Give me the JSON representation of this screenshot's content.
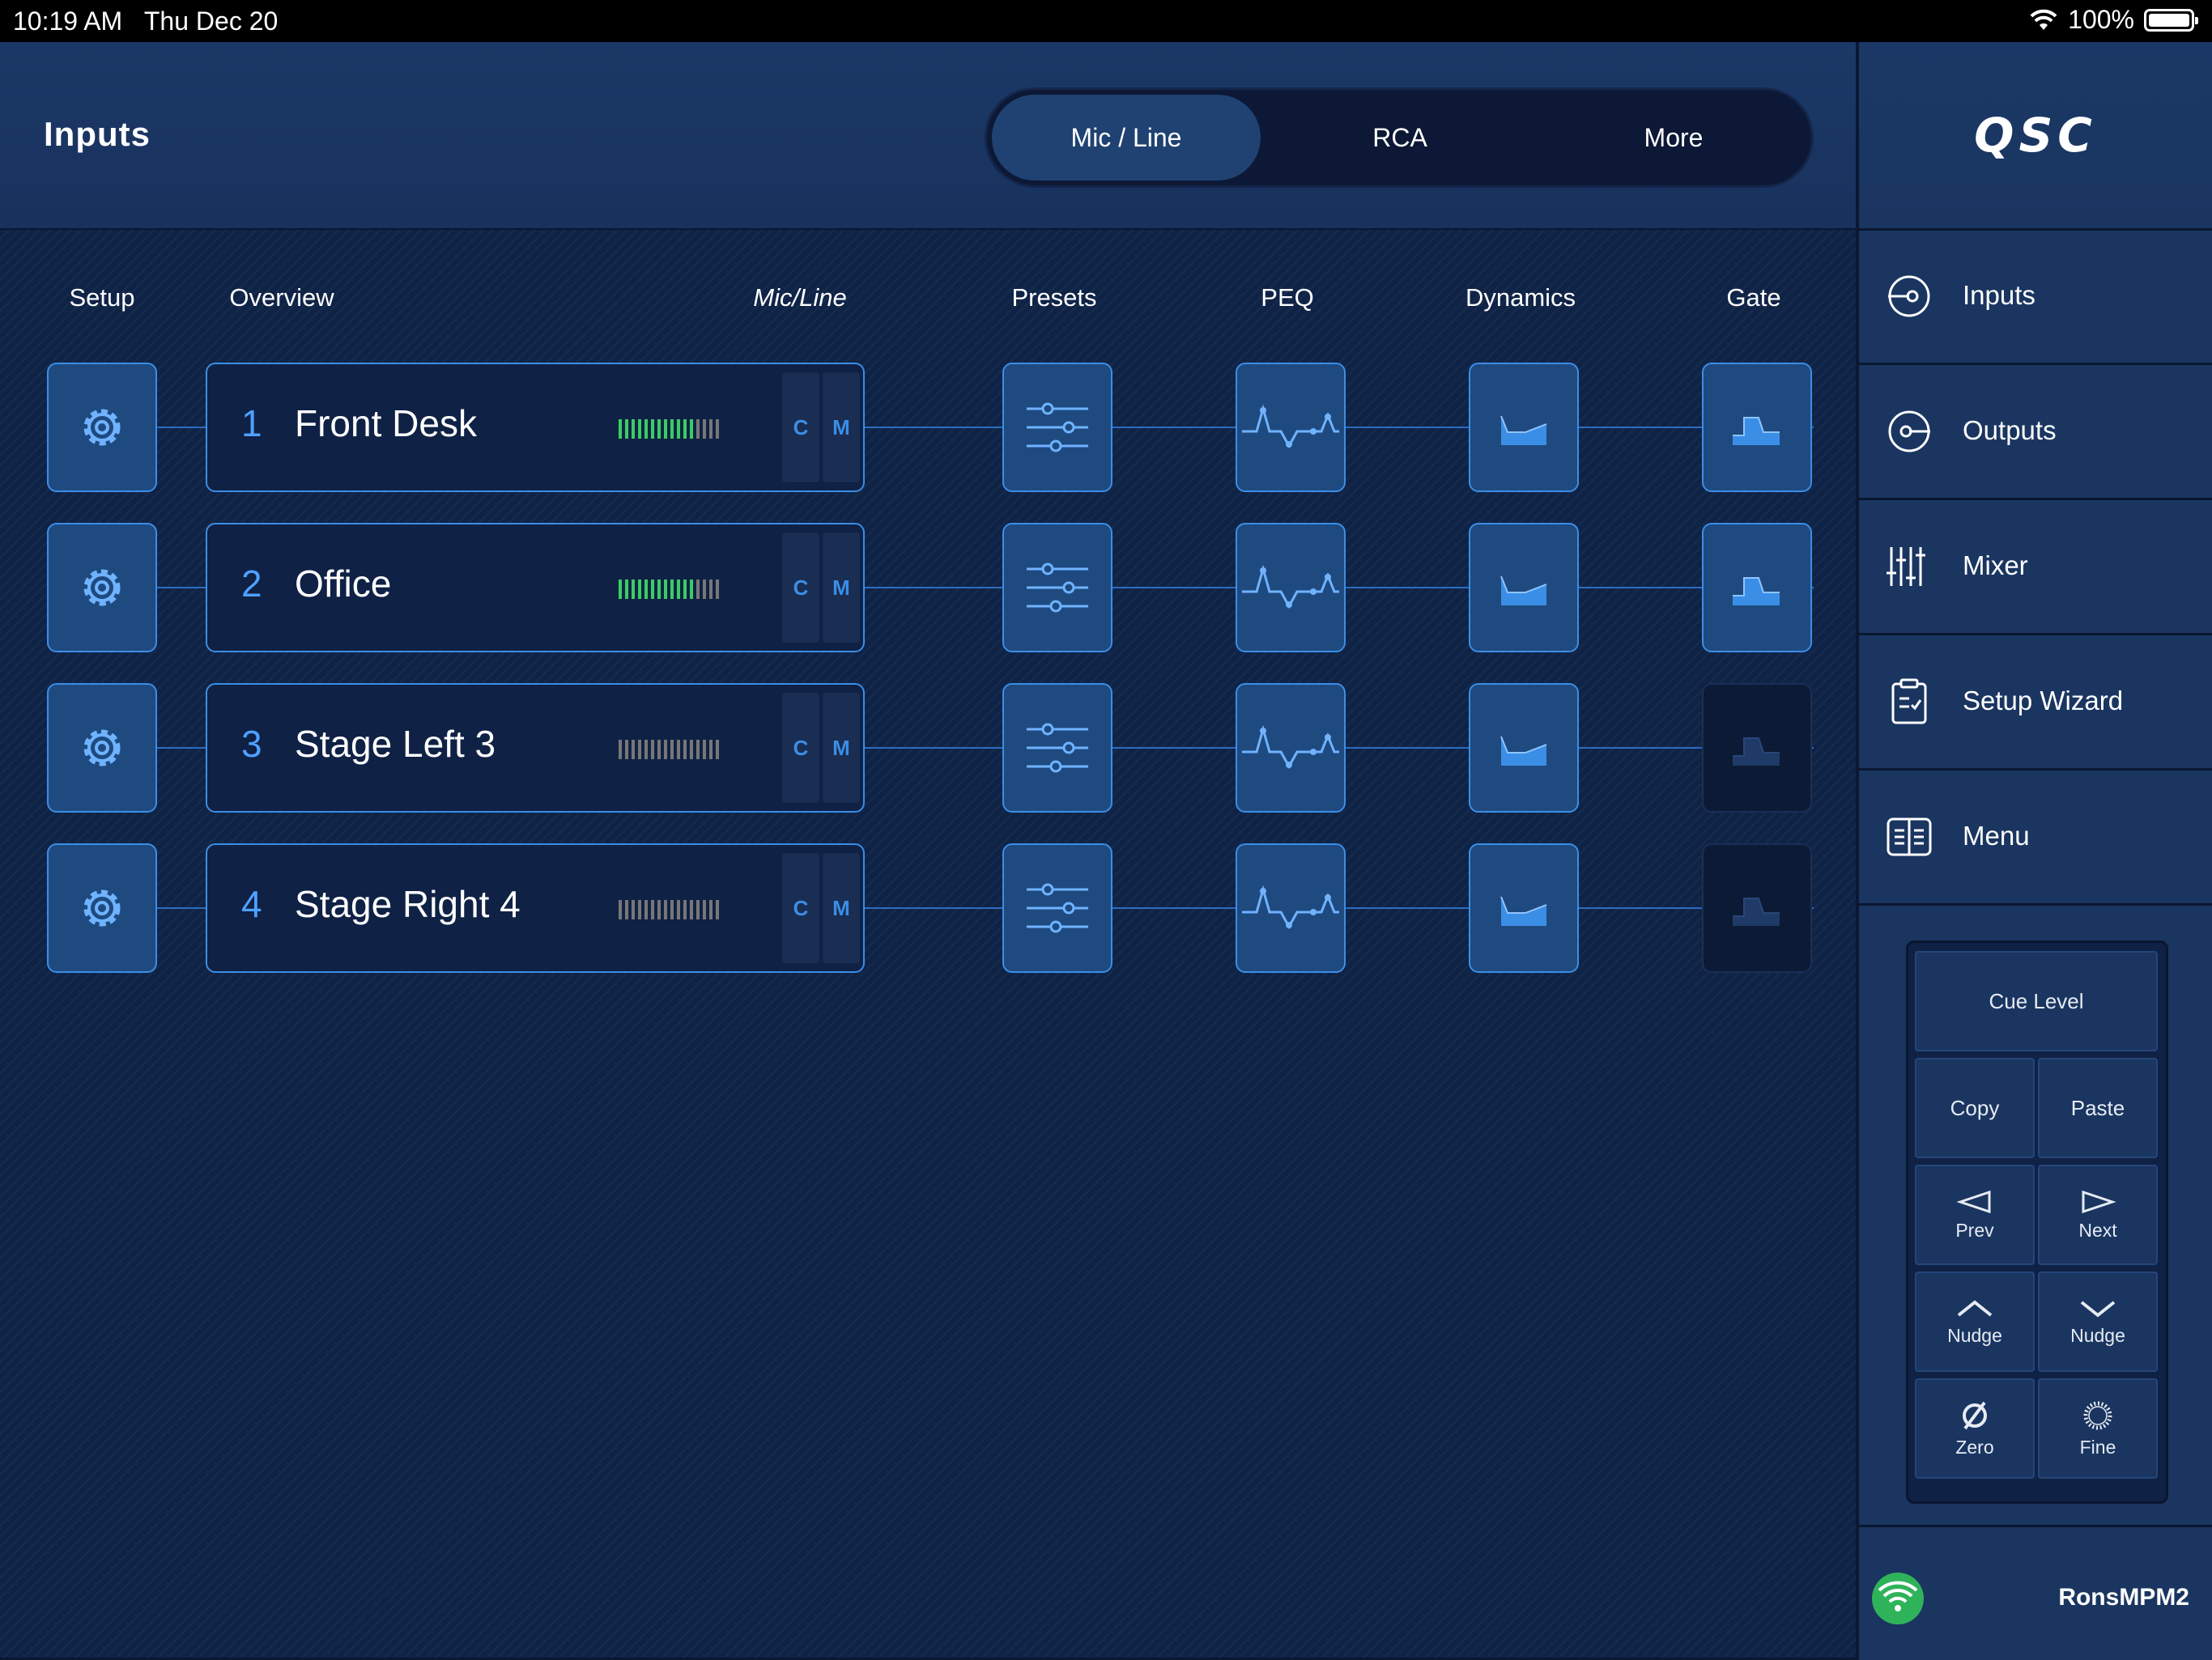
{
  "status_bar": {
    "time": "10:19 AM",
    "date": "Thu Dec 20",
    "battery": "100%"
  },
  "header": {
    "title": "Inputs",
    "tabs": [
      {
        "label": "Mic / Line",
        "active": true
      },
      {
        "label": "RCA",
        "active": false
      },
      {
        "label": "More",
        "active": false
      }
    ]
  },
  "columns": {
    "setup": "Setup",
    "overview": "Overview",
    "mic_line": "Mic/Line",
    "presets": "Presets",
    "peq": "PEQ",
    "dynamics": "Dynamics",
    "gate": "Gate"
  },
  "channels": [
    {
      "number": "1",
      "name": "Front Desk",
      "cue": "C",
      "mute": "M",
      "meter_active": true,
      "gate_enabled": true
    },
    {
      "number": "2",
      "name": "Office",
      "cue": "C",
      "mute": "M",
      "meter_active": true,
      "gate_enabled": true
    },
    {
      "number": "3",
      "name": "Stage Left 3",
      "cue": "C",
      "mute": "M",
      "meter_active": false,
      "gate_enabled": false
    },
    {
      "number": "4",
      "name": "Stage Right 4",
      "cue": "C",
      "mute": "M",
      "meter_active": false,
      "gate_enabled": false
    }
  ],
  "sidebar": {
    "logo": "QSC",
    "nav": [
      {
        "label": "Inputs",
        "icon": "inputs-icon"
      },
      {
        "label": "Outputs",
        "icon": "outputs-icon"
      },
      {
        "label": "Mixer",
        "icon": "mixer-icon"
      },
      {
        "label": "Setup Wizard",
        "icon": "clipboard-icon"
      },
      {
        "label": "Menu",
        "icon": "menu-icon"
      }
    ],
    "panel": {
      "cue_level": "Cue Level",
      "copy": "Copy",
      "paste": "Paste",
      "prev": "Prev",
      "next": "Next",
      "nudge_up": "Nudge",
      "nudge_down": "Nudge",
      "zero": "Zero",
      "fine": "Fine"
    },
    "device_name": "RonsMPM2"
  },
  "colors": {
    "accent": "#3b8ee6",
    "meter_green": "#3bcc63",
    "connected_green": "#2fb35a"
  }
}
